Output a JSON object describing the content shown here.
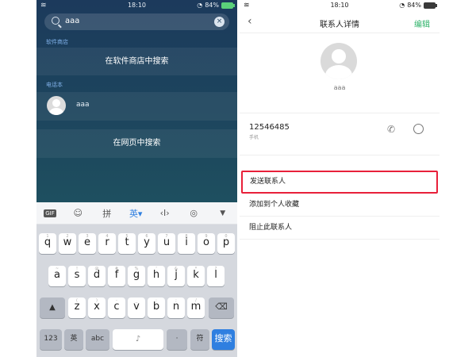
{
  "left": {
    "status": {
      "time": "18:10",
      "battery": "84%"
    },
    "search": {
      "query": "aaa"
    },
    "sections": {
      "store": "软件商店",
      "contacts": "电话本"
    },
    "store_row": "在软件商店中搜索",
    "contact": {
      "name": "aaa"
    },
    "web_row": "在网页中搜索",
    "toolbar": [
      "GIF",
      "☺",
      "拼",
      "英▾",
      "‹I›",
      "◎",
      "▼"
    ],
    "keyboard": {
      "row1": [
        "q",
        "w",
        "e",
        "r",
        "t",
        "y",
        "u",
        "i",
        "o",
        "p"
      ],
      "row1_sub": [
        "1",
        "2",
        "3",
        "4",
        "5",
        "6",
        "7",
        "8",
        "9",
        "0"
      ],
      "row2": [
        "a",
        "s",
        "d",
        "f",
        "g",
        "h",
        "j",
        "k",
        "l"
      ],
      "row2_sub": [
        "~",
        "!",
        "@",
        "#",
        "%",
        "'",
        "&",
        "*",
        "?"
      ],
      "row3": [
        "z",
        "x",
        "c",
        "v",
        "b",
        "n",
        "m"
      ],
      "row3_sub": [
        "(",
        ")",
        "-",
        "_",
        ":",
        ";",
        "/"
      ],
      "bottom": {
        "num": "123",
        "lang": "英",
        "sym": "abc",
        "dot": "·",
        "confirm": "符",
        "search": "搜索"
      }
    }
  },
  "right": {
    "status": {
      "time": "18:10",
      "battery": "84%"
    },
    "nav": {
      "back": "‹",
      "title": "联系人详情",
      "edit": "编辑"
    },
    "contact_name": "aaa",
    "phone": {
      "number": "12546485",
      "type": "手机"
    },
    "actions": [
      "发送联系人",
      "添加到个人收藏",
      "阻止此联系人"
    ]
  },
  "colors": {
    "highlight": "#e8203a",
    "accent_green": "#2fb36a",
    "accent_blue": "#2f7fe0"
  }
}
